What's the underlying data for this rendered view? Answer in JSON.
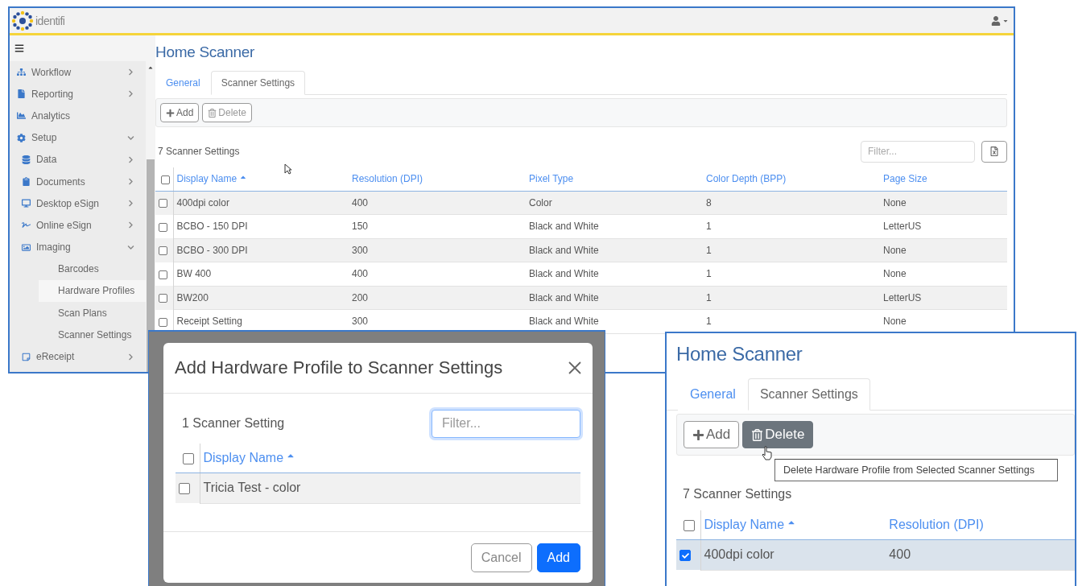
{
  "main_window": {
    "logo_text": "identifi",
    "sidebar": {
      "items": [
        {
          "label": "Workflow",
          "kind": "group",
          "expanded": false
        },
        {
          "label": "Reporting",
          "kind": "group",
          "expanded": false
        },
        {
          "label": "Analytics",
          "kind": "link",
          "selected": false
        },
        {
          "label": "Setup",
          "kind": "group",
          "expanded": true,
          "children": [
            {
              "label": "Data",
              "kind": "group",
              "expanded": false
            },
            {
              "label": "Documents",
              "kind": "group",
              "expanded": false
            },
            {
              "label": "Desktop eSign",
              "kind": "group",
              "expanded": false
            },
            {
              "label": "Online eSign",
              "kind": "group",
              "expanded": false
            },
            {
              "label": "Imaging",
              "kind": "group",
              "expanded": true,
              "children": [
                {
                  "label": "Barcodes",
                  "kind": "link",
                  "selected": false
                },
                {
                  "label": "Hardware Profiles",
                  "kind": "link",
                  "selected": true
                },
                {
                  "label": "Scan Plans",
                  "kind": "link",
                  "selected": false
                },
                {
                  "label": "Scanner Settings",
                  "kind": "link",
                  "selected": false
                }
              ]
            },
            {
              "label": "eReceipt",
              "kind": "group",
              "expanded": false
            }
          ]
        }
      ]
    },
    "page_title": "Home Scanner",
    "tabs": [
      {
        "label": "General",
        "selected": false
      },
      {
        "label": "Scanner Settings",
        "selected": true
      }
    ],
    "toolbar": [
      {
        "label": "Add",
        "kind": "add",
        "disabled": false
      },
      {
        "label": "Delete",
        "kind": "delete",
        "disabled": true
      }
    ],
    "record_count": "7 Scanner Settings",
    "filter": {
      "placeholder": "Filter..."
    },
    "table": {
      "all_checked": false,
      "columns": [
        {
          "label": "Display Name",
          "sorted": true
        },
        {
          "label": "Resolution (DPI)",
          "sorted": false
        },
        {
          "label": "Pixel Type",
          "sorted": false
        },
        {
          "label": "Color Depth (BPP)",
          "sorted": false
        },
        {
          "label": "Page Size",
          "sorted": false
        }
      ],
      "rows": [
        {
          "checked": false,
          "cells": [
            "400dpi color",
            "400",
            "Color",
            "8",
            "None"
          ]
        },
        {
          "checked": false,
          "cells": [
            "BCBO - 150 DPI",
            "150",
            "Black and White",
            "1",
            "LetterUS"
          ]
        },
        {
          "checked": false,
          "cells": [
            "BCBO - 300 DPI",
            "300",
            "Black and White",
            "1",
            "None"
          ]
        },
        {
          "checked": false,
          "cells": [
            "BW 400",
            "400",
            "Black and White",
            "1",
            "None"
          ]
        },
        {
          "checked": false,
          "cells": [
            "BW200",
            "200",
            "Black and White",
            "1",
            "LetterUS"
          ]
        },
        {
          "checked": false,
          "cells": [
            "Receipt Setting",
            "300",
            "Black and White",
            "1",
            "None"
          ]
        }
      ]
    }
  },
  "dialog": {
    "title": "Add Hardware Profile to Scanner Settings",
    "record_count": "1 Scanner Setting",
    "filter": {
      "placeholder": "Filter..."
    },
    "table": {
      "all_checked": false,
      "columns": [
        {
          "label": "Display Name",
          "sorted": true
        }
      ],
      "rows": [
        {
          "checked": false,
          "cells": [
            "Tricia Test - color"
          ]
        }
      ]
    },
    "buttons": [
      {
        "label": "Cancel",
        "kind": "secondary"
      },
      {
        "label": "Add",
        "kind": "primary"
      }
    ]
  },
  "detail_panel": {
    "page_title": "Home Scanner",
    "tabs": [
      {
        "label": "General",
        "selected": false
      },
      {
        "label": "Scanner Settings",
        "selected": true
      }
    ],
    "toolbar": [
      {
        "label": "Add",
        "kind": "add",
        "disabled": false
      },
      {
        "label": "Delete",
        "kind": "delete",
        "disabled": false
      }
    ],
    "tooltip": "Delete Hardware Profile from Selected Scanner Settings",
    "record_count": "7 Scanner Settings",
    "table": {
      "all_checked": false,
      "columns": [
        {
          "label": "Display Name",
          "sorted": true
        },
        {
          "label": "Resolution (DPI)",
          "sorted": false
        }
      ],
      "rows": [
        {
          "checked": true,
          "cells": [
            "400dpi color",
            "400"
          ]
        }
      ]
    }
  }
}
